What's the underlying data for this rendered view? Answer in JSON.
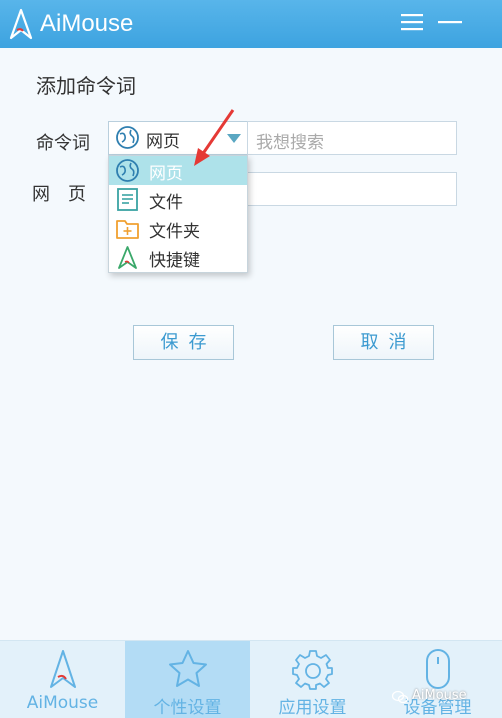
{
  "app": {
    "title": "AiMouse",
    "brand_color": "#3da3e0",
    "window_controls": [
      "menu-icon",
      "minimize-icon"
    ]
  },
  "form": {
    "page_title": "添加命令词",
    "command_label": "命令词",
    "webpage_label": "网　页",
    "combo_value": "网页",
    "combo_icon": "globe-icon",
    "search_placeholder": "我想搜索",
    "webpage_value": ""
  },
  "dropdown": {
    "items": [
      {
        "label": "网页",
        "icon": "globe-icon",
        "selected": true
      },
      {
        "label": "文件",
        "icon": "file-icon",
        "selected": false
      },
      {
        "label": "文件夹",
        "icon": "folder-icon",
        "selected": false
      },
      {
        "label": "快捷键",
        "icon": "shortcut-icon",
        "selected": false
      }
    ]
  },
  "buttons": {
    "save": "保存",
    "cancel": "取消"
  },
  "tabs": [
    {
      "label": "AiMouse",
      "icon": "aimouse-logo-icon",
      "active": false
    },
    {
      "label": "个性设置",
      "icon": "star-icon",
      "active": true
    },
    {
      "label": "应用设置",
      "icon": "gear-icon",
      "active": false
    },
    {
      "label": "设备管理",
      "icon": "mouse-icon",
      "active": false
    }
  ],
  "watermark": "AiMouse",
  "colors": {
    "accent": "#3da3e0",
    "selection": "#aee2ea",
    "active_tab": "#b3dcf5",
    "annotation_arrow": "#e53935"
  }
}
